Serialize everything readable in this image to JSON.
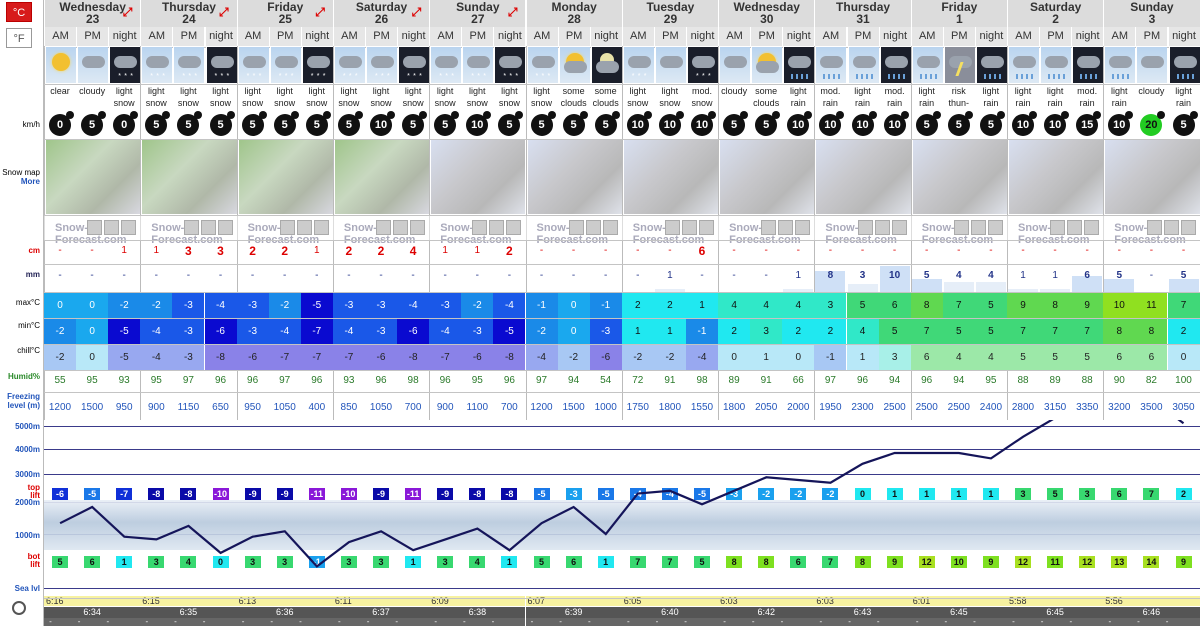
{
  "units": {
    "celsius": "°C",
    "fahrenheit": "°F"
  },
  "labels": {
    "kmh": "km/h",
    "snowmap": "Snow map",
    "more": "More",
    "snow": "cm",
    "rain": "mm",
    "max": "max°C",
    "min": "min°C",
    "chill": "chill°C",
    "humid": "Humid%",
    "freezing1": "Freezing",
    "freezing2": "level (m)",
    "alt5000": "5000m",
    "alt4000": "4000m",
    "alt3000": "3000m",
    "alt2000": "2000m",
    "alt1000": "1000m",
    "sealvl": "Sea lvl",
    "toplift1": "top",
    "toplift2": "lift",
    "botlift1": "bot",
    "botlift2": "lift",
    "logo": "Snow-Forecast.com"
  },
  "periods": [
    "AM",
    "PM",
    "night"
  ],
  "days": [
    {
      "name": "Wednesday",
      "date": "23",
      "expand": true
    },
    {
      "name": "Thursday",
      "date": "24",
      "expand": true
    },
    {
      "name": "Friday",
      "date": "25",
      "expand": true
    },
    {
      "name": "Saturday",
      "date": "26",
      "expand": true
    },
    {
      "name": "Sunday",
      "date": "27",
      "expand": true
    },
    {
      "name": "Monday",
      "date": "28",
      "expand": false
    },
    {
      "name": "Tuesday",
      "date": "29",
      "expand": false
    },
    {
      "name": "Wednesday",
      "date": "30",
      "expand": false
    },
    {
      "name": "Thursday",
      "date": "31",
      "expand": false
    },
    {
      "name": "Friday",
      "date": "1",
      "expand": false
    },
    {
      "name": "Saturday",
      "date": "2",
      "expand": false
    },
    {
      "name": "Sunday",
      "date": "3",
      "expand": false
    }
  ],
  "weather": [
    [
      "clear",
      ""
    ],
    [
      "cloudy",
      ""
    ],
    [
      "light",
      "snow"
    ],
    [
      "light",
      "snow"
    ],
    [
      "light",
      "snow"
    ],
    [
      "light",
      "snow"
    ],
    [
      "light",
      "snow"
    ],
    [
      "light",
      "snow"
    ],
    [
      "light",
      "snow"
    ],
    [
      "light",
      "snow"
    ],
    [
      "light",
      "snow"
    ],
    [
      "light",
      "snow"
    ],
    [
      "light",
      "snow"
    ],
    [
      "light",
      "snow"
    ],
    [
      "light",
      "snow"
    ],
    [
      "light",
      "snow"
    ],
    [
      "some",
      "clouds"
    ],
    [
      "some",
      "clouds"
    ],
    [
      "light",
      "snow"
    ],
    [
      "light",
      "snow"
    ],
    [
      "mod.",
      "snow"
    ],
    [
      "cloudy",
      ""
    ],
    [
      "some",
      "clouds"
    ],
    [
      "light",
      "rain"
    ],
    [
      "mod.",
      "rain"
    ],
    [
      "light",
      "rain"
    ],
    [
      "mod.",
      "rain"
    ],
    [
      "light",
      "rain"
    ],
    [
      "risk",
      "thun-"
    ],
    [
      "light",
      "rain"
    ],
    [
      "light",
      "rain"
    ],
    [
      "light",
      "rain"
    ],
    [
      "mod.",
      "rain"
    ],
    [
      "light",
      "rain"
    ],
    [
      "cloudy",
      ""
    ],
    [
      "light",
      "rain"
    ]
  ],
  "icons": [
    "sun",
    "cloud",
    "night-snow",
    "cloud-snow",
    "cloud-snow",
    "night-snow",
    "cloud-snow",
    "cloud-snow",
    "night-snow",
    "cloud-snow",
    "cloud-snow",
    "night-snow",
    "cloud-snow",
    "cloud-snow",
    "night-snow",
    "cloud-snow",
    "sun-cloud",
    "moon-cloud",
    "cloud-snow",
    "cloud",
    "night-snow",
    "cloud",
    "sun-cloud",
    "night-rain",
    "cloud-rain",
    "cloud-rain",
    "night-rain",
    "cloud-rain",
    "thunder",
    "night-rain",
    "cloud-rain",
    "cloud-rain",
    "night-rain",
    "cloud-rain",
    "cloud",
    "night-rain"
  ],
  "wind": [
    "0",
    "5",
    "0",
    "5",
    "5",
    "5",
    "5",
    "5",
    "5",
    "5",
    "10",
    "5",
    "5",
    "10",
    "5",
    "5",
    "5",
    "5",
    "10",
    "10",
    "10",
    "5",
    "5",
    "10",
    "10",
    "10",
    "10",
    "5",
    "5",
    "5",
    "10",
    "10",
    "15",
    "10",
    "20",
    "5"
  ],
  "snow": [
    "-",
    "-",
    "1",
    "1",
    "3",
    "3",
    "2",
    "2",
    "1",
    "2",
    "2",
    "4",
    "1",
    "1",
    "2",
    "-",
    "-",
    "-",
    "-",
    "-",
    "6",
    "-",
    "-",
    "-",
    "-",
    "-",
    "-",
    "-",
    "-",
    "-",
    "-",
    "-",
    "-",
    "-",
    "-",
    "-"
  ],
  "rain": [
    "-",
    "-",
    "-",
    "-",
    "-",
    "-",
    "-",
    "-",
    "-",
    "-",
    "-",
    "-",
    "-",
    "-",
    "-",
    "-",
    "-",
    "-",
    "-",
    "1",
    "-",
    "-",
    "-",
    "1",
    "8",
    "3",
    "10",
    "5",
    "4",
    "4",
    "1",
    "1",
    "6",
    "5",
    "-",
    "5"
  ],
  "maxT": [
    "0",
    "0",
    "-2",
    "-2",
    "-3",
    "-4",
    "-3",
    "-2",
    "-5",
    "-3",
    "-3",
    "-4",
    "-3",
    "-2",
    "-4",
    "-1",
    "0",
    "-1",
    "2",
    "2",
    "1",
    "4",
    "4",
    "4",
    "3",
    "5",
    "6",
    "8",
    "7",
    "5",
    "9",
    "8",
    "9",
    "10",
    "11",
    "7"
  ],
  "minT": [
    "-2",
    "0",
    "-5",
    "-4",
    "-3",
    "-6",
    "-3",
    "-4",
    "-7",
    "-4",
    "-3",
    "-6",
    "-4",
    "-3",
    "-5",
    "-2",
    "0",
    "-3",
    "1",
    "1",
    "-1",
    "2",
    "3",
    "2",
    "2",
    "4",
    "5",
    "7",
    "5",
    "5",
    "7",
    "7",
    "7",
    "8",
    "8",
    "2"
  ],
  "chill": [
    "-2",
    "0",
    "-5",
    "-4",
    "-3",
    "-8",
    "-6",
    "-7",
    "-7",
    "-7",
    "-6",
    "-8",
    "-7",
    "-6",
    "-8",
    "-4",
    "-2",
    "-6",
    "-2",
    "-2",
    "-4",
    "0",
    "1",
    "0",
    "-1",
    "1",
    "3",
    "6",
    "4",
    "4",
    "5",
    "5",
    "5",
    "6",
    "6",
    "0"
  ],
  "humid": [
    "55",
    "95",
    "93",
    "95",
    "97",
    "96",
    "96",
    "97",
    "96",
    "93",
    "96",
    "98",
    "96",
    "95",
    "96",
    "97",
    "94",
    "54",
    "72",
    "91",
    "98",
    "89",
    "91",
    "66",
    "97",
    "96",
    "94",
    "96",
    "94",
    "95",
    "88",
    "89",
    "88",
    "90",
    "82",
    "100"
  ],
  "freezing": [
    "1200",
    "1500",
    "950",
    "900",
    "1150",
    "650",
    "950",
    "1050",
    "400",
    "850",
    "1050",
    "700",
    "900",
    "1100",
    "700",
    "1200",
    "1500",
    "1000",
    "1750",
    "1800",
    "1550",
    "1800",
    "2050",
    "2000",
    "1950",
    "2300",
    "2500",
    "2500",
    "2500",
    "2400",
    "2800",
    "3150",
    "3350",
    "3200",
    "3500",
    "3050"
  ],
  "toplift": [
    "-6",
    "-5",
    "-7",
    "-8",
    "-8",
    "-10",
    "-9",
    "-9",
    "-11",
    "-10",
    "-9",
    "-11",
    "-9",
    "-8",
    "-8",
    "-5",
    "-3",
    "-5",
    "-4",
    "-4",
    "-5",
    "-3",
    "-2",
    "-2",
    "-2",
    "0",
    "1",
    "1",
    "1",
    "1",
    "3",
    "5",
    "3",
    "6",
    "7",
    "2"
  ],
  "botlift": [
    "5",
    "6",
    "1",
    "3",
    "4",
    "0",
    "3",
    "3",
    "-1",
    "3",
    "3",
    "1",
    "3",
    "4",
    "1",
    "5",
    "6",
    "1",
    "7",
    "7",
    "5",
    "8",
    "8",
    "6",
    "7",
    "8",
    "9",
    "12",
    "10",
    "9",
    "12",
    "11",
    "12",
    "13",
    "14",
    "9"
  ],
  "sunrise": [
    "6:16",
    "6:15",
    "6:13",
    "6:11",
    "6:09",
    "6:07",
    "6:05",
    "6:03",
    "6:03",
    "6:01",
    "5:58",
    "5:56"
  ],
  "sunset": [
    "6:34",
    "6:35",
    "6:36",
    "6:37",
    "6:38",
    "6:39",
    "6:40",
    "6:42",
    "6:43",
    "6:45",
    "6:45",
    "6:46"
  ],
  "colors": {
    "accent": "#dd1122",
    "blue_dark": "#0a0aa8",
    "blue": "#1a78e8",
    "cyan": "#20e8f0",
    "green": "#38d870",
    "lime": "#7ee020",
    "purple": "#8a2be2"
  }
}
